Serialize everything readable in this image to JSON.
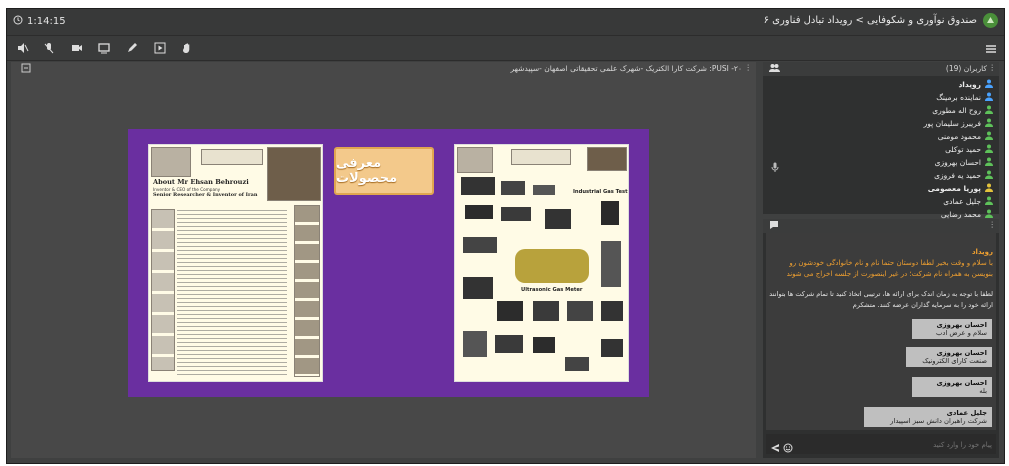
{
  "topbar": {
    "timer": "1:14:15",
    "title": "صندوق نوآوری و شکوفایی > رویداد تبادل فناوری ۶"
  },
  "toolbar": {
    "tools": [
      "mute-speaker-icon",
      "mute-mic-icon",
      "camera-icon",
      "screen-share-icon",
      "pen-icon",
      "play-video-icon",
      "raise-hand-icon"
    ]
  },
  "stage": {
    "title": "PUSI -۲۰: شرکت کارا الکتریک -شهرک علمی تحقیقاتی اصفهان -سپیدشهر",
    "slide": {
      "center_label": "معرفی محصولات",
      "left_header": "About Mr Ehsan Behrouzi",
      "left_sub": "Inventor & CEO of the Company",
      "left_sub2": "Senior Researcher & Inventor of Iran",
      "right_header": "Industrial Gas Test",
      "right_caption": "Ultrasonic Gas Meter"
    }
  },
  "users": {
    "header": "کاربران (19)",
    "list": [
      {
        "name": "رویداد",
        "color": "#4aa3ff"
      },
      {
        "name": "نماینده برمینگ",
        "color": "#4aa3ff"
      },
      {
        "name": "روح اله مطوری",
        "color": "#5ec25a"
      },
      {
        "name": "فریبرز سلیمان پور",
        "color": "#5ec25a"
      },
      {
        "name": "محمود مومنی",
        "color": "#5ec25a"
      },
      {
        "name": "حمید توکلی",
        "color": "#5ec25a"
      },
      {
        "name": "احسان بهروزی",
        "color": "#5ec25a"
      },
      {
        "name": "حمید یه فروزی",
        "color": "#5ec25a"
      },
      {
        "name": "پوریا معصومی",
        "color": "#e3c33c"
      },
      {
        "name": "جلیل عمادی",
        "color": "#5ec25a"
      },
      {
        "name": "محمد رضایی",
        "color": "#5ec25a"
      }
    ]
  },
  "chat": {
    "welcome_title": "رویداد",
    "welcome_text": "با سلام و وقت بخیر لطفا دوستان حتما نام و نام خانوادگی خودشون رو بنویسن به همراه نام شرکت؛ در غیر اینصورت از جلسه اخراج می شوند",
    "note": "لطفا با توجه به زمان اندک برای ارائه ها، ترتیبی اتخاذ کنید تا تمام شرکت ها بتوانند ارائه خود را به سرمایه گذاران عرضه کنند. متشکرم",
    "messages": [
      {
        "who": "احسان بهروزی",
        "text": "سلام و عرض ادب"
      },
      {
        "who": "احسان بهروزی",
        "text": "صنعت کارای الکترونیک"
      },
      {
        "who": "احسان بهروزی",
        "text": "بله"
      },
      {
        "who": "جلیل عمادی",
        "text": "شرکت راهبران دانش سبز اسپیدار"
      }
    ],
    "input_placeholder": "پیام خود را وارد کنید"
  },
  "colors": {
    "accent_orange": "#f0a030",
    "slide_bg": "#6a2fa0"
  }
}
